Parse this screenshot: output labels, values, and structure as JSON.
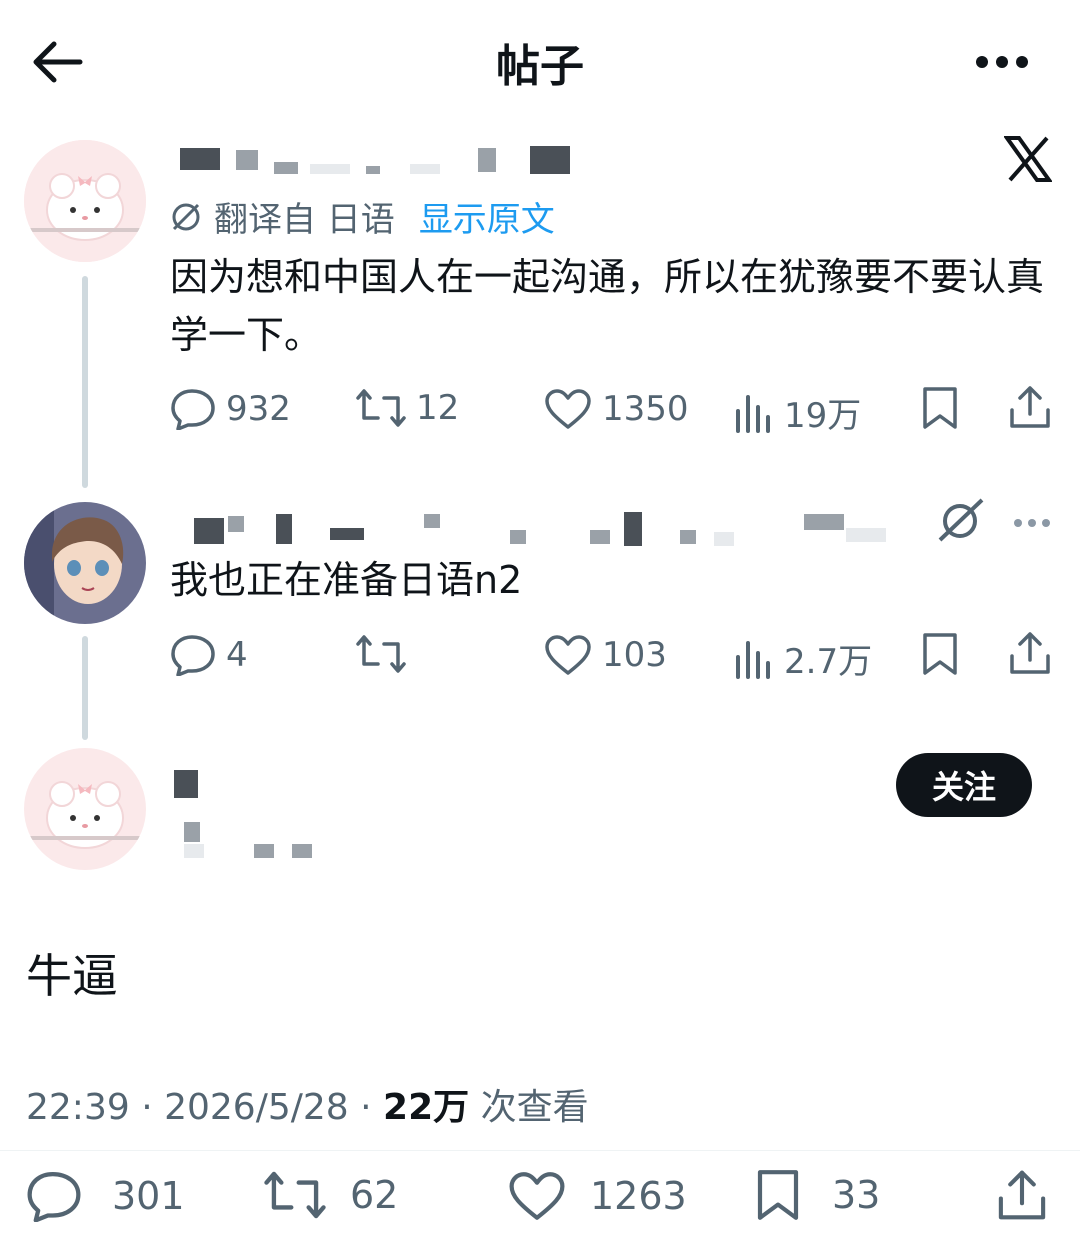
{
  "header": {
    "title": "帖子"
  },
  "tweet1": {
    "translate_label": "翻译自 日语",
    "show_original": "显示原文",
    "text": "因为想和中国人在一起沟通，所以在犹豫要不要认真学一下。",
    "stats": {
      "replies": "932",
      "retweets": "12",
      "likes": "1350",
      "views": "19万"
    }
  },
  "tweet2": {
    "text": "我也正在准备日语n2",
    "stats": {
      "replies": "4",
      "retweets": "",
      "likes": "103",
      "views": "2.7万"
    }
  },
  "main_post": {
    "follow_label": "关注",
    "text": "牛逼",
    "time": "22:39",
    "date": "2026/5/28",
    "views_count": "22万",
    "views_suffix": "次查看",
    "stats": {
      "replies": "301",
      "retweets": "62",
      "likes": "1263",
      "bookmarks": "33"
    }
  },
  "colors": {
    "link": "#1d9bf0",
    "muted": "#536471",
    "text": "#0f1419"
  }
}
